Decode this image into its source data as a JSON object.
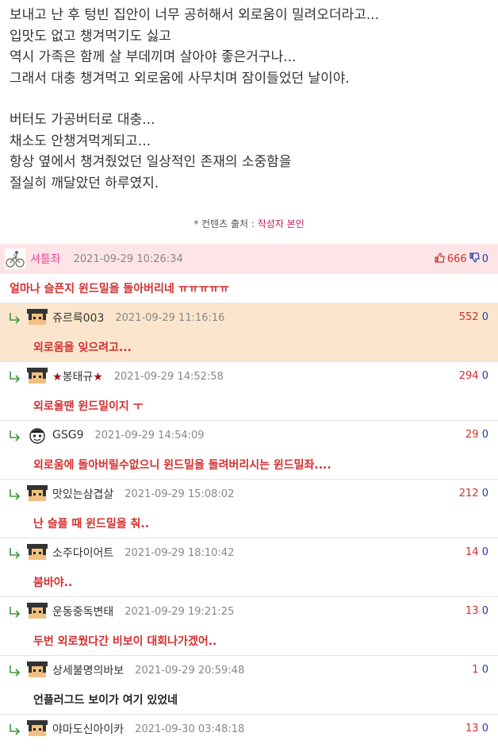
{
  "article": {
    "paragraphs": [
      [
        "보내고 난 후 텅빈 집안이 너무 공허해서 외로움이 밀려오더라고...",
        "입맛도 없고 챙겨먹기도 싫고",
        "역시 가족은 함께 살 부데끼며 살아야 좋은거구나...",
        "그래서 대충 챙겨먹고 외로움에 사무치며 잠이들었던 날이야."
      ],
      [
        "버터도 가공버터로 대충...",
        "채소도 안챙겨먹게되고...",
        "항상 옆에서 챙겨줬었던 일상적인 존재의 소중함을",
        "절실히 깨달았던 하루였지."
      ]
    ],
    "source_prefix": "* 컨텐츠 출처 : ",
    "source_author": "작성자 본인"
  },
  "best_comment": {
    "nick": "셔틀좌",
    "date": "2021-09-29 10:26:34",
    "up": "666",
    "down": "0",
    "text": "얼마나 슬픈지 윈드밀을 돌아버리네 ㅠㅠㅠㅠㅠ"
  },
  "replies": [
    {
      "nick": "쥬르륵003",
      "date": "2021-09-29 11:16:16",
      "up": "552",
      "down": "0",
      "text": "외로움을 잊으려고..."
    },
    {
      "nick": "봉태규",
      "date": "2021-09-29 14:52:58",
      "up": "294",
      "down": "0",
      "text": "외로울땐 윈드밀이지 ㅜ"
    },
    {
      "nick": "GSG9",
      "date": "2021-09-29 14:54:09",
      "up": "29",
      "down": "0",
      "text": "외로움에 돌아버릴수없으니 윈드밀을 돌려버리시는 윈드밀좌...."
    },
    {
      "nick": "맛있는삼겹살",
      "date": "2021-09-29 15:08:02",
      "up": "212",
      "down": "0",
      "text": "난 슬플 때 윈드밀을 춰.."
    },
    {
      "nick": "소주다이어트",
      "date": "2021-09-29 18:10:42",
      "up": "14",
      "down": "0",
      "text": "붐바야.."
    },
    {
      "nick": "운동중독변태",
      "date": "2021-09-29 19:21:25",
      "up": "13",
      "down": "0",
      "text": "두번 외로웠다간 비보이 대회나가겠어.."
    },
    {
      "nick": "상세불명의바보",
      "date": "2021-09-29 20:59:48",
      "up": "1",
      "down": "0",
      "text": "언플러그드 보이가 여기 있었네"
    },
    {
      "nick": "야마도신아이카",
      "date": "2021-09-30 03:48:18",
      "up": "13",
      "down": "0",
      "text": ""
    }
  ],
  "colors": {
    "best_bg": "#fde4e6",
    "highlight_bg": "#fbe6cd",
    "up": "#d32f2f",
    "down": "#1e3fa8"
  },
  "icons": {
    "reply": "reply-arrow-icon",
    "thumb_up": "thumb-up-icon",
    "thumb_down": "thumb-down-icon"
  }
}
